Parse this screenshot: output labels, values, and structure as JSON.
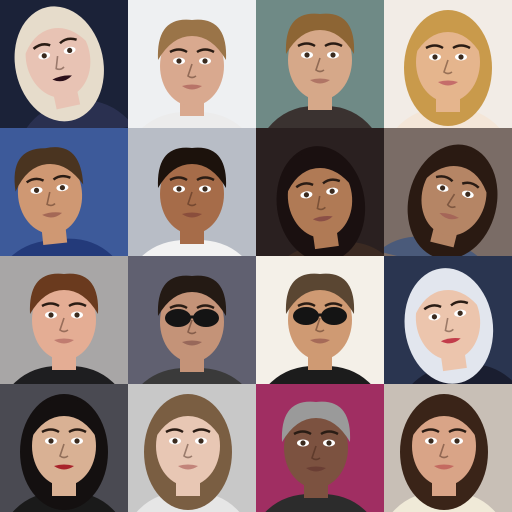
{
  "grid": {
    "rows": 4,
    "columns": 4,
    "tiles": [
      {
        "label": "",
        "bg": "#1b2238",
        "skin": "#e8c3b4",
        "hair": "#e6dccb",
        "shirt": "#2a3050",
        "lips": "#2b0f1a"
      },
      {
        "label": "",
        "bg": "#eef0f2",
        "skin": "#d9a98f",
        "hair": "#9a7448",
        "shirt": "#ececec",
        "lips": "#b87468"
      },
      {
        "label": "",
        "bg": "#6f8a86",
        "skin": "#d6a889",
        "hair": "#8d6534",
        "shirt": "#3a3230",
        "lips": "#b07565"
      },
      {
        "label": "",
        "bg": "#f2ece6",
        "skin": "#e5b58d",
        "hair": "#c99a4b",
        "shirt": "#f4e6d8",
        "lips": "#c56d6a"
      },
      {
        "label": "",
        "bg": "#3d5a9a",
        "skin": "#cf9873",
        "hair": "#4a3420",
        "shirt": "#233a7a",
        "lips": "#a46856"
      },
      {
        "label": "",
        "bg": "#b8bdc6",
        "skin": "#a66c49",
        "hair": "#1c120c",
        "shirt": "#f2f2f2",
        "lips": "#8a4e3c"
      },
      {
        "label": "",
        "bg": "#2a2020",
        "skin": "#b07a55",
        "hair": "#1a1010",
        "shirt": "#3b2a22",
        "lips": "#8b4f46"
      },
      {
        "label": "",
        "bg": "#7a6c66",
        "skin": "#b58565",
        "hair": "#2a1a12",
        "shirt": "#4a5a7a",
        "lips": "#a56658"
      },
      {
        "label": "",
        "bg": "#a8a6a6",
        "skin": "#e4ad94",
        "hair": "#6a3a1e",
        "shirt": "#1e1e20",
        "lips": "#c07c70"
      },
      {
        "label": "",
        "bg": "#606070",
        "skin": "#c49378",
        "hair": "#241a14",
        "shirt": "#3a3a3a",
        "lips": "#98685a"
      },
      {
        "label": "",
        "bg": "#f4f0e8",
        "skin": "#cf9a73",
        "hair": "#5a4632",
        "shirt": "#1c1c1c",
        "lips": "#a66a58"
      },
      {
        "label": "",
        "bg": "#2a3550",
        "skin": "#ecc5ad",
        "hair": "#e2e6ee",
        "shirt": "#1a1e30",
        "lips": "#c23c4a"
      },
      {
        "label": "",
        "bg": "#4a4a52",
        "skin": "#d9b194",
        "hair": "#141010",
        "shirt": "#1a1a1a",
        "lips": "#a8222a"
      },
      {
        "label": "",
        "bg": "#c8c8c8",
        "skin": "#e8c7b4",
        "hair": "#7a5e42",
        "shirt": "#e6e6e6",
        "lips": "#c2847a"
      },
      {
        "label": "",
        "bg": "#a02e62",
        "skin": "#7c5240",
        "hair": "#9a9a9a",
        "shirt": "#2c2c2c",
        "lips": "#6a3e34"
      },
      {
        "label": "",
        "bg": "#c8bfb6",
        "skin": "#d9a487",
        "hair": "#3a2418",
        "shirt": "#f0ead8",
        "lips": "#c46a60"
      }
    ]
  }
}
